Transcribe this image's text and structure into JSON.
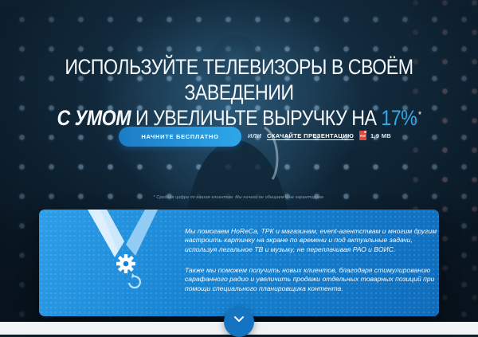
{
  "colors": {
    "accent": "#33a9e8",
    "button": "#1c7cc5",
    "card": "#1683d2",
    "pdf": "#e04a3d"
  },
  "hero": {
    "headline_line1": "Используйте телевизоры в своём заведении",
    "headline_strong": "с умом",
    "headline_mid": " и увеличьте выручку на ",
    "headline_accent": "17%",
    "headline_sup": "*",
    "cta_label": "Начните бесплатно",
    "or_text": "или",
    "download_link": "Скачайте презентацию",
    "file_icon": "pdf-icon",
    "file_size": "1,9 MB",
    "footnote": "* Средняя цифра по нашим клиентам. Мы ничего не обещаем и не гарантируем."
  },
  "card": {
    "icon": "gear-icon",
    "paragraph1": "Мы помогаем HoReCa, ТРК и магазинам, event-агентствам и многим другим настроить картинку на экране по времени и под актуальные задачи, используя легальное ТВ и музыку, не переплачивая РАО и ВОИС.",
    "paragraph2": "Также мы поможем получить новых клиентов, благодаря стимулированию сарафанного радио и увеличить продажи отдельных товарных позиций при помощи специального планировщика контента."
  },
  "scroll_icon": "chevron-down-icon"
}
